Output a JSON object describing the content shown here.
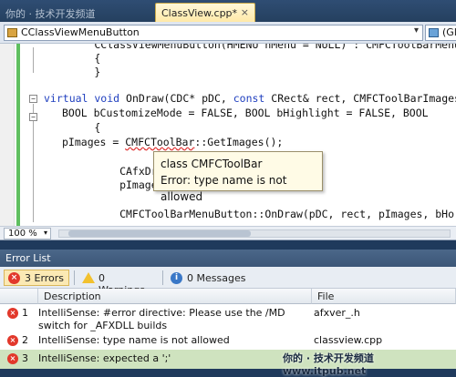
{
  "tabs": {
    "inactive_tab": "你的 · 技术开发频道 www.itpub.net",
    "active_tab": "ClassView.cpp*",
    "close_glyph": "×"
  },
  "navbar": {
    "class_combo": "CClassViewMenuButton",
    "member_combo": "(Glob"
  },
  "editor": {
    "lines": [
      "        CClassViewMenuButton(HMENU hMenu = NULL) : CMFCToolBarMenuButton(",
      "        {",
      "        }",
      "",
      "        virtual void OnDraw(CDC* pDC, const CRect& rect, CMFCToolBarImages*",
      "            BOOL bCustomizeMode = FALSE, BOOL bHighlight = FALSE, BOOL",
      "        {",
      "            pImages = CMFCToolBar::GetImages();",
      "",
      "            CAfxDrawSt",
      "            pImages->P",
      "",
      "            CMFCToolBarMenuButton::OnDraw(pDC, rect, pImages, bHorz, b"
    ],
    "tooltip_line1": "class CMFCToolBar",
    "tooltip_line2": "Error: type name is not allowed",
    "zoom": "100 %"
  },
  "error_list": {
    "title": "Error List",
    "errors_filter": "3 Errors",
    "warnings_filter": "0 Warnings",
    "messages_filter": "0 Messages",
    "columns": {
      "description": "Description",
      "file": "File"
    },
    "rows": [
      {
        "num": "1",
        "description": "IntelliSense: #error directive: Please use the /MD switch for _AFXDLL builds",
        "file": "afxver_.h"
      },
      {
        "num": "2",
        "description": "IntelliSense: type name is not allowed",
        "file": "classview.cpp"
      },
      {
        "num": "3",
        "description": "IntelliSense: expected a ';'",
        "file": ""
      }
    ]
  },
  "watermarks": {
    "bottom": "你的 · 技术开发频道 www.itpub.net"
  },
  "colors": {
    "keyword": "#1f3fbf",
    "error_red": "#e2382b",
    "selected_row": "#cfe3bf"
  }
}
